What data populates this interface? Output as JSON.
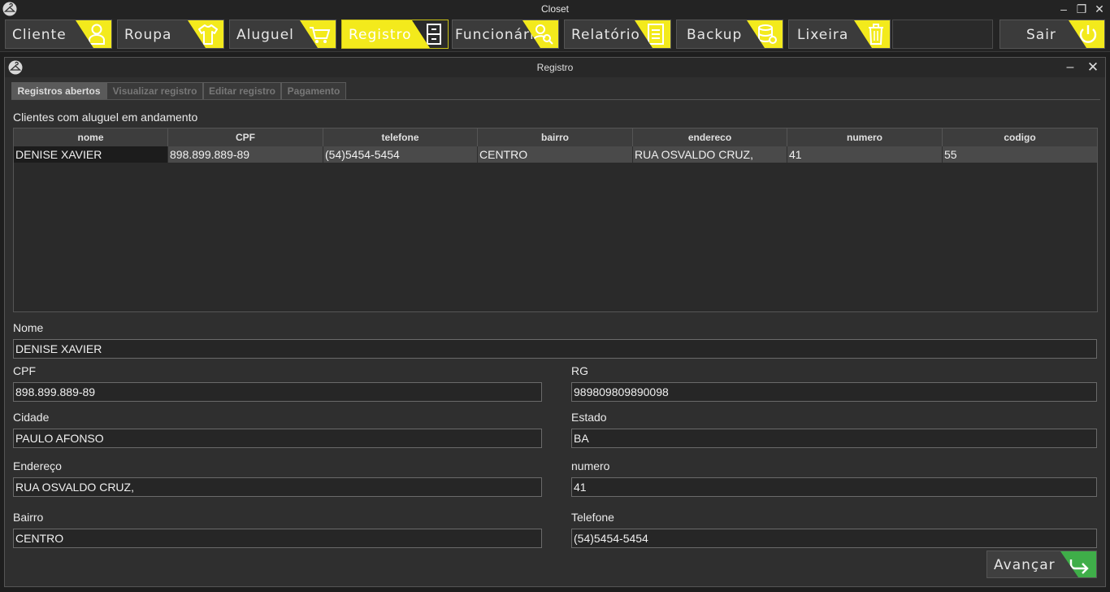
{
  "window": {
    "title": "Closet",
    "minimize": "–",
    "maximize": "❐",
    "close": "✕"
  },
  "toolbar": {
    "items": [
      {
        "label": "Cliente",
        "icon": "user-icon"
      },
      {
        "label": "Roupa",
        "icon": "shirt-icon"
      },
      {
        "label": "Aluguel",
        "icon": "cart-icon"
      },
      {
        "label": "Registro",
        "icon": "cabinet-icon",
        "active": true
      },
      {
        "label": "Funcionário",
        "icon": "employee-icon"
      },
      {
        "label": "Relatório",
        "icon": "report-icon"
      },
      {
        "label": "Backup",
        "icon": "database-icon"
      },
      {
        "label": "Lixeira",
        "icon": "trash-icon"
      }
    ],
    "exit_label": "Sair",
    "accent": "#f3ea1c"
  },
  "frame": {
    "title": "Registro",
    "minimize": "–",
    "close": "✕",
    "tabs": [
      "Registros abertos",
      "Visualizar registro",
      "Editar registro",
      "Pagamento"
    ],
    "caption": "Clientes com aluguel em andamento"
  },
  "table": {
    "columns": [
      "nome",
      "CPF",
      "telefone",
      "bairro",
      "endereco",
      "numero",
      "codigo"
    ],
    "rows": [
      [
        "DENISE XAVIER",
        "898.899.889-89",
        "(54)5454-5454",
        "CENTRO",
        "RUA OSVALDO CRUZ,",
        "41",
        "55"
      ]
    ]
  },
  "form": {
    "nome_label": "Nome",
    "nome": "DENISE XAVIER",
    "cpf_label": "CPF",
    "cpf": "898.899.889-89",
    "rg_label": "RG",
    "rg": "989809809890098",
    "cidade_label": "Cidade",
    "cidade": "PAULO AFONSO",
    "estado_label": "Estado",
    "estado": "BA",
    "endereco_label": "Endereço",
    "endereco": "RUA OSVALDO CRUZ,",
    "numero_label": "numero",
    "numero": "41",
    "bairro_label": "Bairro",
    "bairro": "CENTRO",
    "telefone_label": "Telefone",
    "telefone": "(54)5454-5454"
  },
  "next_button": {
    "label": "Avançar",
    "icon": "forward-arrow-icon",
    "color": "#3fae49"
  }
}
